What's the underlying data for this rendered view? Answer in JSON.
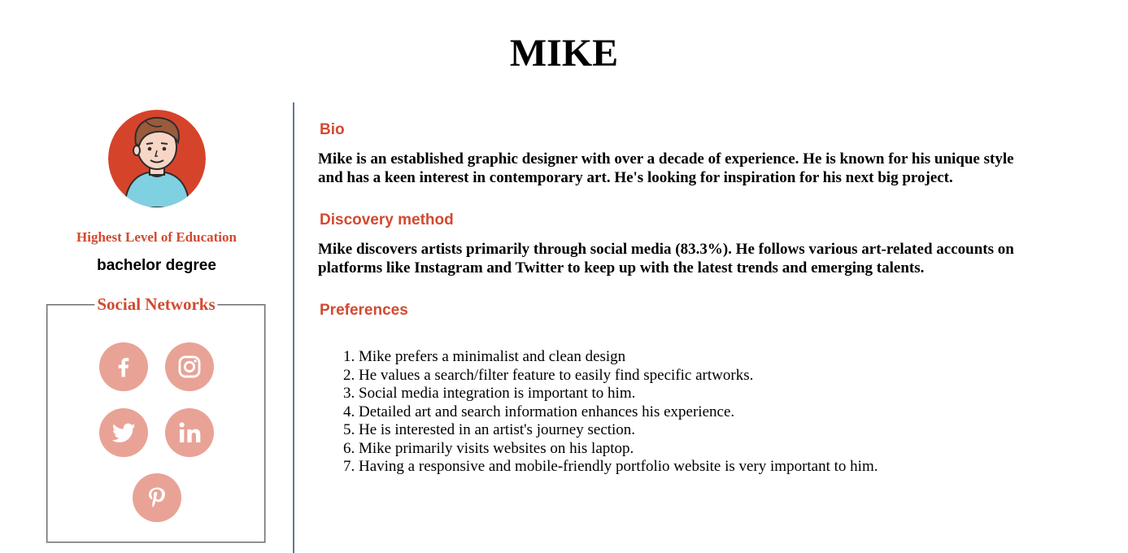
{
  "persona": {
    "name": "MIKE",
    "education": {
      "label": "Highest Level of Education",
      "value": "bachelor degree"
    }
  },
  "social": {
    "legend": "Social Networks",
    "networks": [
      {
        "name": "facebook",
        "icon": "facebook-icon"
      },
      {
        "name": "instagram",
        "icon": "instagram-icon"
      },
      {
        "name": "twitter",
        "icon": "twitter-icon"
      },
      {
        "name": "linkedin",
        "icon": "linkedin-icon"
      },
      {
        "name": "pinterest",
        "icon": "pinterest-icon"
      }
    ]
  },
  "sections": {
    "bio": {
      "heading": "Bio",
      "text": "Mike is an established graphic designer with over a decade of experience. He is known for his unique style and has a keen interest in contemporary art. He's looking for inspiration for his next big project."
    },
    "discovery": {
      "heading": "Discovery method",
      "text": "Mike discovers artists primarily through social media (83.3%). He follows various art-related accounts on platforms like Instagram and Twitter to keep up with the latest trends and emerging talents."
    },
    "preferences": {
      "heading": "Preferences",
      "items": [
        "Mike prefers a minimalist and clean design",
        "He values a search/filter feature to easily find specific artworks.",
        "Social media integration is important to him.",
        "Detailed art and search information enhances his experience.",
        "He is interested in an artist's journey section.",
        "Mike primarily visits websites on his laptop.",
        "Having a responsive and mobile-friendly portfolio website is very important to him."
      ]
    }
  },
  "colors": {
    "accent": "#d24a30",
    "social_icon_bg": "#e8a396",
    "divider": "#5b7a9a",
    "avatar_bg": "#d6432b",
    "shirt": "#7fd0e0",
    "hair": "#9a5b3c",
    "skin": "#f7d6c6"
  }
}
